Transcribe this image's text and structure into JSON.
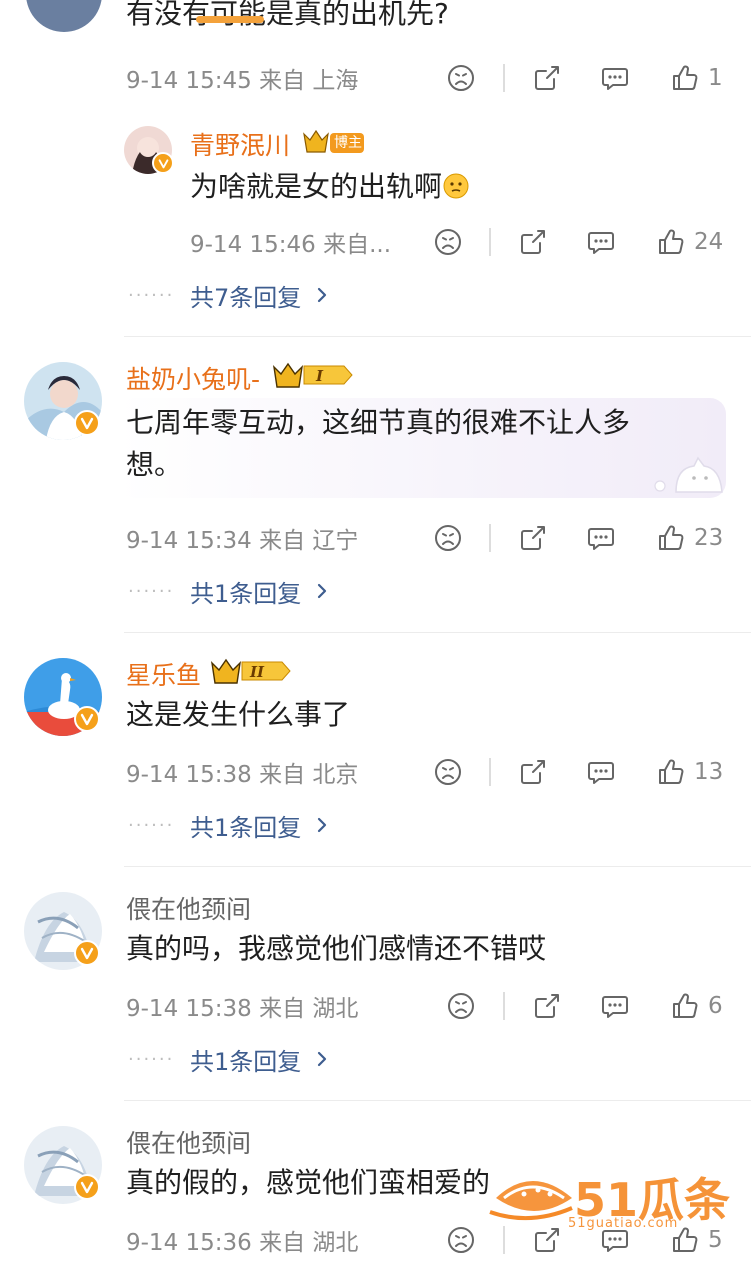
{
  "top_partial": {
    "text": "有没有可能是真的出机先?",
    "time_location": "9-14 15:45  来自 上海",
    "like_count": "1"
  },
  "sub_reply": {
    "username": "青野泯川",
    "badge": "博主",
    "text": "为啥就是女的出轨啊",
    "time_location": "9-14 15:46  来自...",
    "like_count": "24",
    "more_replies": "共7条回复"
  },
  "comments": [
    {
      "username": "盐奶小兔叽-",
      "level": "I",
      "text_line1": "七周年零互动，这细节真的很难不让人多",
      "text_line2": "想。",
      "time_location": "9-14 15:34  来自 辽宁",
      "like_count": "23",
      "more_replies": "共1条回复"
    },
    {
      "username": "星乐鱼",
      "level": "II",
      "text": "这是发生什么事了",
      "time_location": "9-14 15:38  来自 北京",
      "like_count": "13",
      "more_replies": "共1条回复"
    },
    {
      "username": "偎在他颈间",
      "text": "真的吗，我感觉他们感情还不错哎",
      "time_location": "9-14 15:38  来自 湖北",
      "like_count": "6",
      "more_replies": "共1条回复"
    },
    {
      "username": "偎在他颈间",
      "text": "真的假的，感觉他们蛮相爱的",
      "time_location": "9-14 15:36  来自 湖北",
      "like_count": "5"
    }
  ],
  "watermark": {
    "brand": "51瓜条",
    "url": "51guatiao.com"
  },
  "colors": {
    "username_orange": "#e8701a",
    "reply_link_blue": "#3e5d8f",
    "meta_gray": "#8a8a8a",
    "verified_badge": "#f5a01a"
  }
}
